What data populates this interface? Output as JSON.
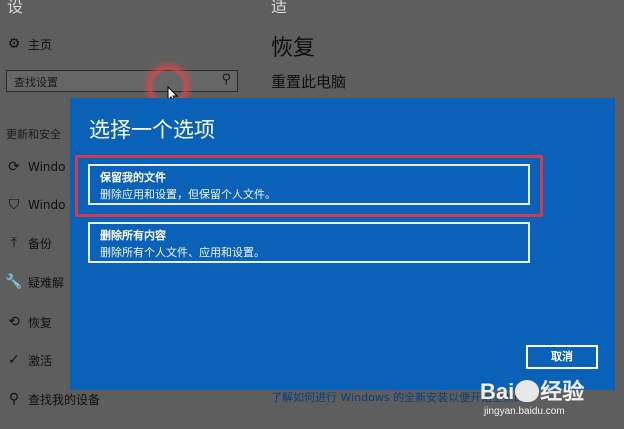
{
  "top_fragments": [
    "设",
    "适"
  ],
  "sidebar": {
    "home": "主页",
    "search_placeholder": "查找设置",
    "section_header": "更新和安全",
    "items": [
      {
        "label": "Windo",
        "icon": "sync-icon"
      },
      {
        "label": "Windo",
        "icon": "shield-icon"
      },
      {
        "label": "备份",
        "icon": "backup-icon"
      },
      {
        "label": "疑难解",
        "icon": "wrench-icon"
      },
      {
        "label": "恢复",
        "icon": "recovery-icon"
      },
      {
        "label": "激活",
        "icon": "check-circle-icon"
      },
      {
        "label": "查找我的设备",
        "icon": "locate-icon"
      }
    ]
  },
  "main": {
    "title": "恢复",
    "subtitle": "重置此电脑",
    "bottom_link": "了解如何进行 Windows 的全新安装以便开始全新的"
  },
  "dialog": {
    "title": "选择一个选项",
    "options": [
      {
        "title": "保留我的文件",
        "desc": "删除应用和设置，但保留个人文件。"
      },
      {
        "title": "删除所有内容",
        "desc": "删除所有个人文件、应用和设置。"
      }
    ],
    "cancel": "取消"
  },
  "watermark": {
    "logo_left": "Bai",
    "logo_right": "经验",
    "url": "jingyan.baidu.com"
  },
  "colors": {
    "dialog_bg": "#0a62b8",
    "highlight_red": "#d93a4a",
    "dim_bg": "#5e5e5e"
  }
}
